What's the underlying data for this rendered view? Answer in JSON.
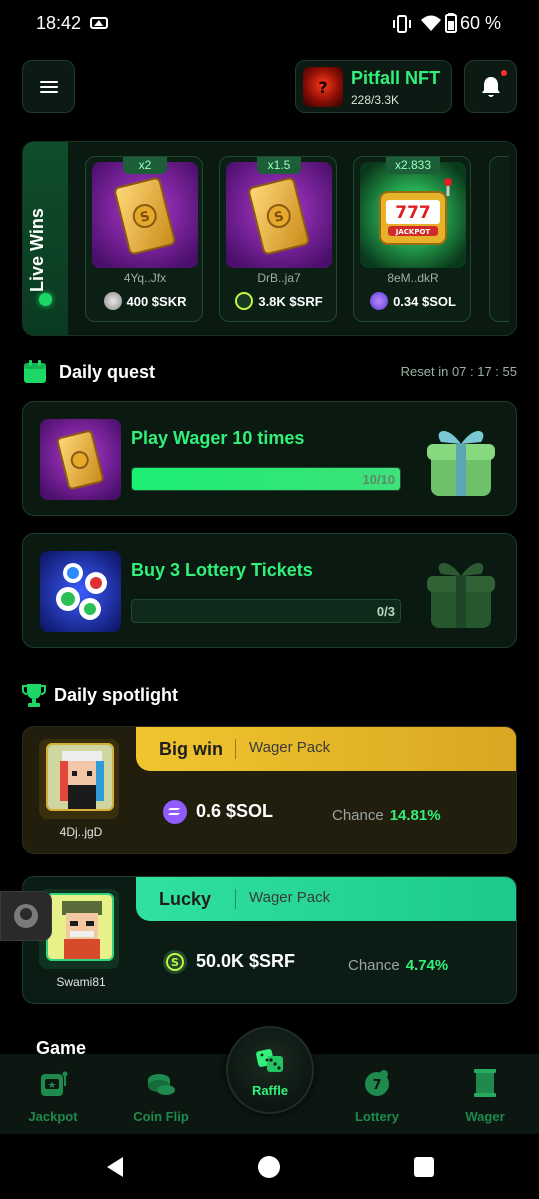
{
  "status_bar": {
    "time": "18:42",
    "battery_pct": "60 %"
  },
  "header": {
    "nft_title": "Pitfall NFT",
    "nft_count": "228/3.3K",
    "menu_icon": "hamburger-icon",
    "bell_icon": "bell-icon"
  },
  "live_wins": {
    "label": "Live Wins",
    "items": [
      {
        "multiplier": "x2",
        "user": "4Yq..Jfx",
        "amount": "400 $SKR",
        "coin": "skr",
        "art": "wager-pack"
      },
      {
        "multiplier": "x1.5",
        "user": "DrB..ja7",
        "amount": "3.8K $SRF",
        "coin": "srf",
        "art": "wager-pack"
      },
      {
        "multiplier": "x2.833",
        "user": "8eM..dkR",
        "amount": "0.34 $SOL",
        "coin": "sol",
        "art": "jackpot-slot"
      }
    ]
  },
  "daily_quest": {
    "title": "Daily quest",
    "reset": "Reset in 07 : 17 : 55",
    "quests": [
      {
        "title": "Play Wager 10 times",
        "progress": "10/10",
        "fraction": 1.0,
        "thumb": "wager-pack"
      },
      {
        "title": "Buy 3 Lottery Tickets",
        "progress": "0/3",
        "fraction": 0.0,
        "thumb": "lottery-balls"
      }
    ]
  },
  "daily_spotlight": {
    "title": "Daily spotlight",
    "entries": [
      {
        "label": "Big win",
        "sub": "Wager Pack",
        "user": "4Dj..jgD",
        "amount": "0.6 $SOL",
        "chance_label": "Chance",
        "chance": "14.81%"
      },
      {
        "label": "Lucky",
        "sub": "Wager Pack",
        "user": "Swami81",
        "amount": "50.0K $SRF",
        "chance_label": "Chance",
        "chance": "4.74%"
      }
    ]
  },
  "game_section": {
    "title": "Game"
  },
  "bottom_nav": {
    "items": [
      {
        "label": "Jackpot",
        "icon": "jackpot-icon"
      },
      {
        "label": "Coin Flip",
        "icon": "coin-flip-icon"
      },
      {
        "label": "Raffle",
        "icon": "dice-icon"
      },
      {
        "label": "Lottery",
        "icon": "lottery-icon"
      },
      {
        "label": "Wager",
        "icon": "wager-icon"
      }
    ]
  },
  "colors": {
    "accent": "#32f07a",
    "gold": "#f0c530",
    "teal": "#31e1a0",
    "bg": "#000000"
  }
}
